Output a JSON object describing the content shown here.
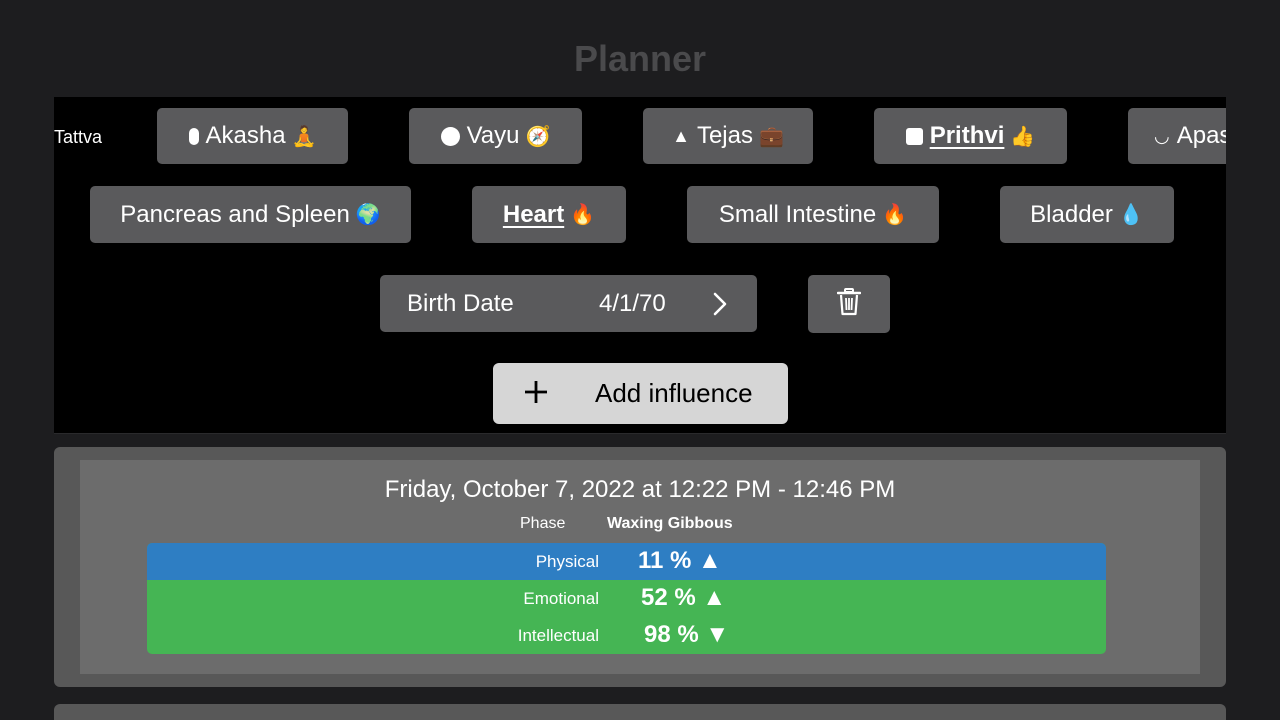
{
  "header": {
    "title": "Planner"
  },
  "tattva": {
    "label": "Tattva",
    "items": [
      {
        "name": "Akasha",
        "emoji": "🧘",
        "shape": "pill",
        "selected": false
      },
      {
        "name": "Vayu",
        "emoji": "🧭",
        "shape": "circle",
        "selected": false
      },
      {
        "name": "Tejas",
        "emoji": "💼",
        "shape": "triangle",
        "selected": false
      },
      {
        "name": "Prithvi",
        "emoji": "👍",
        "shape": "square",
        "selected": true
      },
      {
        "name": "Apas",
        "emoji": "",
        "shape": "crescent",
        "selected": false
      }
    ]
  },
  "organs": {
    "items": [
      {
        "name": "Pancreas and Spleen",
        "emoji": "🌍",
        "selected": false
      },
      {
        "name": "Heart",
        "emoji": "🔥",
        "selected": true
      },
      {
        "name": "Small Intestine",
        "emoji": "🔥",
        "selected": false
      },
      {
        "name": "Bladder",
        "emoji": "💧",
        "selected": false
      }
    ]
  },
  "birth": {
    "label": "Birth Date",
    "value": "4/1/70"
  },
  "add_influence": {
    "label": "Add influence"
  },
  "card": {
    "date": "Friday, October 7, 2022 at 12:22 PM - 12:46 PM",
    "phase_label": "Phase",
    "phase_value": "Waxing Gibbous",
    "biorhythms": [
      {
        "name": "Physical",
        "value": "11 % ▲",
        "color": "#2e7ec3"
      },
      {
        "name": "Emotional",
        "value": "52 % ▲",
        "color": "#45b554"
      },
      {
        "name": "Intellectual",
        "value": "98 % ▼",
        "color": "#45b554"
      }
    ]
  },
  "colors": {
    "background": "#1d1d1f",
    "button": "#5a5a5c",
    "add_button": "#d6d6d6",
    "physical": "#2e7ec3",
    "emotional": "#45b554"
  },
  "icons": {
    "trash": "trash-icon",
    "plus": "plus-icon",
    "chevron": "chevron-right-icon"
  }
}
